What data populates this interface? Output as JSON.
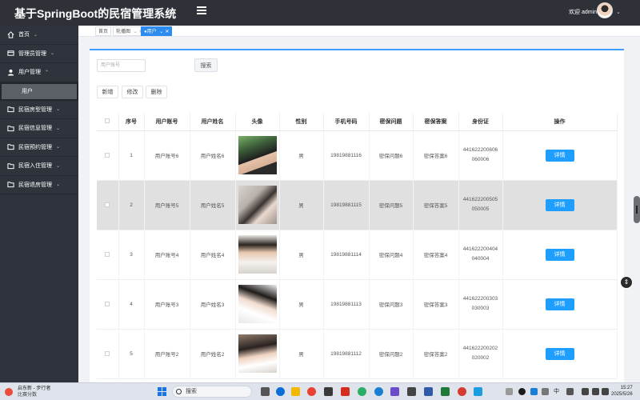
{
  "header": {
    "title": "基于SpringBoot的民宿管理系统",
    "welcome": "欢迎 admin"
  },
  "sidebar": {
    "items": [
      {
        "label": "首页",
        "icon": "home-icon"
      },
      {
        "label": "管理员管理",
        "icon": "admin-icon"
      },
      {
        "label": "用户管理",
        "icon": "user-icon",
        "expanded": true,
        "children": [
          {
            "label": "用户"
          }
        ]
      },
      {
        "label": "民宿房型管理",
        "icon": "folder-icon"
      },
      {
        "label": "民宿信息管理",
        "icon": "folder-icon"
      },
      {
        "label": "民宿预约管理",
        "icon": "folder-icon"
      },
      {
        "label": "民宿入住管理",
        "icon": "folder-icon"
      },
      {
        "label": "民宿退房管理",
        "icon": "folder-icon"
      }
    ]
  },
  "tabs": [
    {
      "label": "首页",
      "active": false
    },
    {
      "label": "轮播图",
      "active": false
    },
    {
      "label": "●用户",
      "active": true
    }
  ],
  "search": {
    "placeholder": "用户账号",
    "button": "搜索"
  },
  "actions": {
    "add": "新增",
    "edit": "修改",
    "delete": "删除"
  },
  "table": {
    "columns": [
      "序号",
      "用户账号",
      "用户姓名",
      "头像",
      "性别",
      "手机号码",
      "密保问题",
      "密保答案",
      "身份证",
      "操作"
    ],
    "detail_label": "详情",
    "rows": [
      {
        "index": "1",
        "account": "用户账号6",
        "name": "用户姓名6",
        "gender": "男",
        "phone": "19819881116",
        "question": "密保问题6",
        "answer": "密保答案6",
        "id_line1": "441622200606",
        "id_line2": "060006",
        "highlighted": false
      },
      {
        "index": "2",
        "account": "用户账号5",
        "name": "用户姓名5",
        "gender": "男",
        "phone": "19819881115",
        "question": "密保问题5",
        "answer": "密保答案5",
        "id_line1": "441622200505",
        "id_line2": "050005",
        "highlighted": true
      },
      {
        "index": "3",
        "account": "用户账号4",
        "name": "用户姓名4",
        "gender": "男",
        "phone": "19819881114",
        "question": "密保问题4",
        "answer": "密保答案4",
        "id_line1": "441622200404",
        "id_line2": "040004",
        "highlighted": false
      },
      {
        "index": "4",
        "account": "用户账号3",
        "name": "用户姓名3",
        "gender": "男",
        "phone": "19819881113",
        "question": "密保问题3",
        "answer": "密保答案3",
        "id_line1": "441622200303",
        "id_line2": "030003",
        "highlighted": false
      },
      {
        "index": "5",
        "account": "用户账号2",
        "name": "用户姓名2",
        "gender": "男",
        "phone": "19819881112",
        "question": "密保问题2",
        "answer": "密保答案2",
        "id_line1": "441622200202",
        "id_line2": "020002",
        "highlighted": false
      }
    ]
  },
  "taskbar": {
    "weather_line1": "启东新 - 步行者",
    "weather_line2": "比赛分数",
    "search_label": "搜索",
    "lang": "中",
    "time": "15:27",
    "date": "2025/5/26"
  },
  "colors": {
    "sidebar_bg": "#2f333c",
    "topbar_bg": "#2e3138",
    "accent": "#409eff",
    "detail_button": "#1e9fff"
  }
}
